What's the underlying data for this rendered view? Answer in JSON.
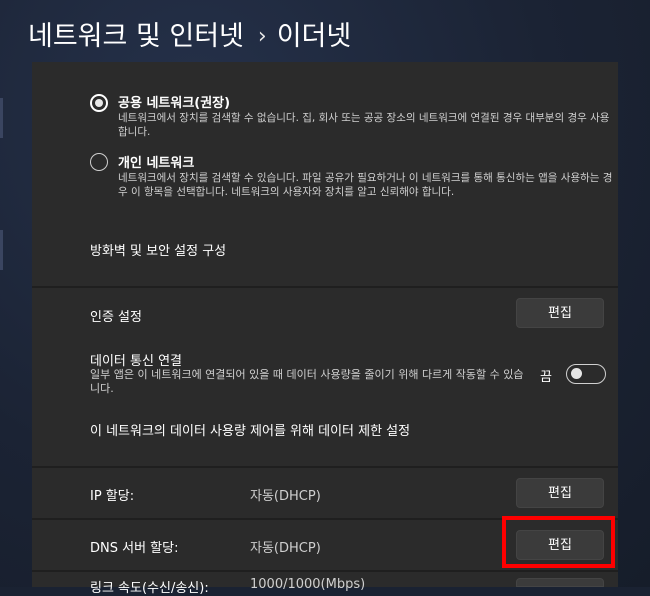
{
  "header": {
    "title": "네트워크 및 인터넷",
    "separator": "›",
    "current": "이더넷"
  },
  "network_profile": {
    "options": [
      {
        "title": "공용 네트워크(권장)",
        "description": "네트워크에서 장치를 검색할 수 없습니다. 집, 회사 또는 공공 장소의 네트워크에 연결된 경우 대부분의 경우 사용합니다.",
        "selected": true
      },
      {
        "title": "개인 네트워크",
        "description": "네트워크에서 장치를 검색할 수 있습니다. 파일 공유가 필요하거나 이 네트워크를 통해 통신하는 앱을 사용하는 경우 이 항목을 선택합니다. 네트워크의 사용자와 장치를 알고 신뢰해야 합니다.",
        "selected": false
      }
    ],
    "firewall_link": "방화벽 및 보안 설정 구성"
  },
  "auth": {
    "label": "인증 설정",
    "button": "편집"
  },
  "metered": {
    "title": "데이터 통신 연결",
    "description": "일부 앱은 이 네트워크에 연결되어 있을 때 데이터 사용량을 줄이기 위해 다르게 작동할 수 있습니다.",
    "state_label": "끔",
    "enabled": false,
    "data_limit_link": "이 네트워크의 데이터 사용량 제어를 위해 데이터 제한 설정"
  },
  "ip": {
    "label": "IP 할당:",
    "value": "자동(DHCP)",
    "button": "편집"
  },
  "dns": {
    "label": "DNS 서버 할당:",
    "value": "자동(DHCP)",
    "button": "편집"
  },
  "link_speed": {
    "label": "링크 속도(수신/송신):",
    "value": "1000/1000(Mbps)"
  },
  "colors": {
    "accent_highlight": "#ff0000",
    "panel": "#2b2b2b",
    "background": "#1a2232"
  }
}
